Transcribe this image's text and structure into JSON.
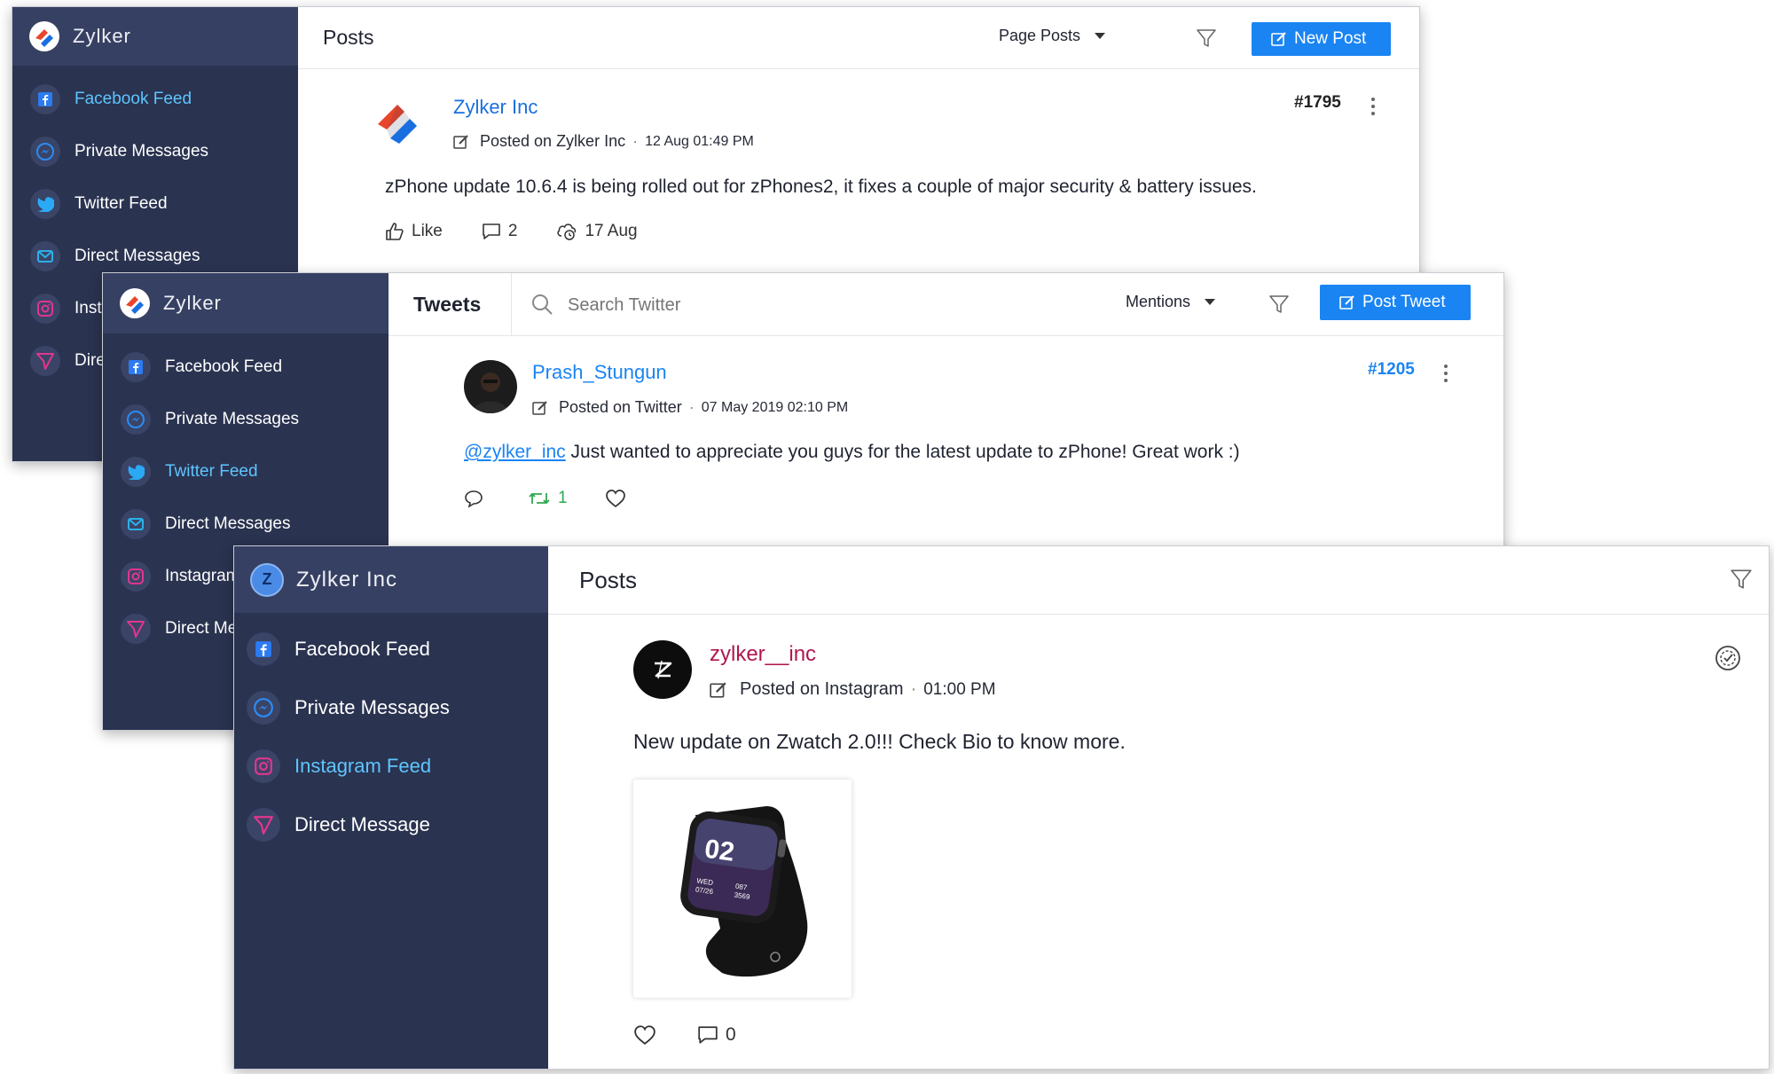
{
  "colors": {
    "sidebar_bg": "#2a3350",
    "sidebar_head": "#364062",
    "active_nav": "#5fc5ff",
    "accent_blue": "#1a84f2",
    "instagram_author": "#b0174f",
    "retweet_green": "#2fa84f"
  },
  "panel1": {
    "brand": "Zylker",
    "nav": [
      {
        "label": "Facebook Feed",
        "icon": "facebook-icon",
        "active": true
      },
      {
        "label": "Private Messages",
        "icon": "messenger-icon"
      },
      {
        "label": "Twitter Feed",
        "icon": "twitter-icon"
      },
      {
        "label": "Direct Messages",
        "icon": "mail-icon"
      },
      {
        "label": "Insta",
        "icon": "instagram-icon"
      },
      {
        "label": "Dire",
        "icon": "direct-send-icon"
      }
    ],
    "title": "Posts",
    "dropdown": "Page Posts",
    "new_post": "New Post",
    "post": {
      "author": "Zylker Inc",
      "posted_on": "Posted on Zylker Inc",
      "time": "12 Aug 01:49 PM",
      "id": "#1795",
      "text": "zPhone update 10.6.4 is being rolled out for zPhones2, it fixes a couple of major security & battery issues.",
      "like": "Like",
      "comments": "2",
      "schedule": "17 Aug"
    }
  },
  "panel2": {
    "brand": "Zylker",
    "nav": [
      {
        "label": "Facebook Feed",
        "icon": "facebook-icon"
      },
      {
        "label": "Private Messages",
        "icon": "messenger-icon"
      },
      {
        "label": "Twitter Feed",
        "icon": "twitter-icon",
        "active": true
      },
      {
        "label": "Direct Messages",
        "icon": "mail-icon"
      },
      {
        "label": "Instagram",
        "icon": "instagram-icon"
      },
      {
        "label": "Direct Me",
        "icon": "direct-send-icon"
      }
    ],
    "title": "Tweets",
    "search_placeholder": "Search Twitter",
    "dropdown": "Mentions",
    "post_tweet": "Post Tweet",
    "post": {
      "author": "Prash_Stungun",
      "posted_on": "Posted on Twitter",
      "time": "07 May 2019 02:10 PM",
      "id": "#1205",
      "mention": "@zylker_inc",
      "text": " Just wanted to appreciate you guys for the latest update to zPhone! Great work :)",
      "retweets": "1"
    }
  },
  "panel3": {
    "brand": "Zylker Inc",
    "brand_initial": "Z",
    "nav": [
      {
        "label": "Facebook Feed",
        "icon": "facebook-icon"
      },
      {
        "label": "Private Messages",
        "icon": "messenger-icon"
      },
      {
        "label": "Instagram Feed",
        "icon": "instagram-icon",
        "active": true
      },
      {
        "label": "Direct Message",
        "icon": "direct-send-icon"
      }
    ],
    "title": "Posts",
    "post": {
      "author": "zylker__inc",
      "posted_on": "Posted on Instagram",
      "time": "01:00 PM",
      "text": "New update on Zwatch 2.0!!! Check Bio to know more.",
      "watch_big": "02",
      "watch_day": "WED",
      "watch_date": "07/26",
      "watch_stat1": "087",
      "watch_stat2": "3569",
      "comments": "0"
    }
  }
}
